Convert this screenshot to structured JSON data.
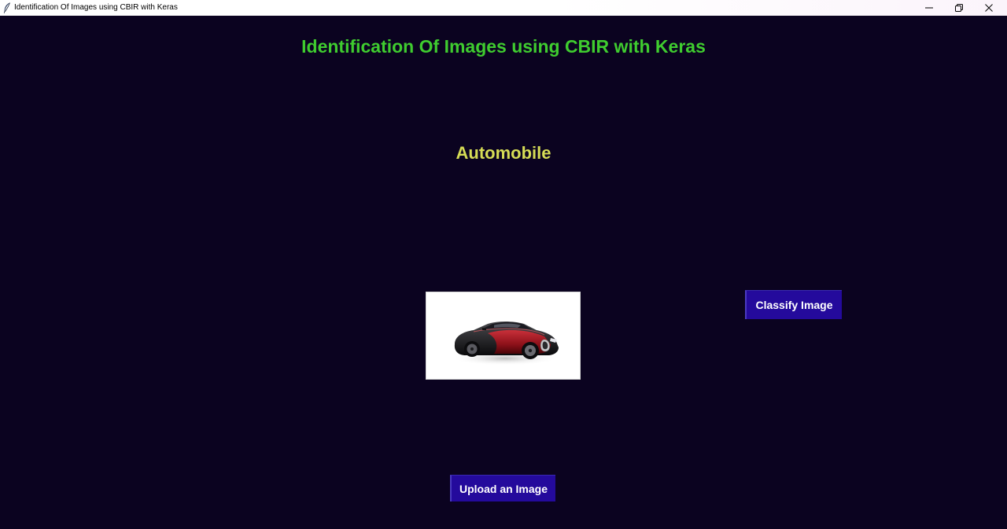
{
  "window": {
    "title": "Identification Of Images using CBIR with Keras",
    "app_icon": "feather-icon",
    "controls": [
      "minimize-icon",
      "restore-icon",
      "close-icon"
    ]
  },
  "header": {
    "title": "Identification Of Images using CBIR with Keras",
    "title_color": "#3fcc2f"
  },
  "result": {
    "label": "Automobile",
    "label_color": "#d6dc55"
  },
  "preview": {
    "image_subject": "red-black-sports-car"
  },
  "buttons": {
    "classify_label": "Classify Image",
    "upload_label": "Upload an Image",
    "button_color": "#240a9c"
  },
  "colors": {
    "background": "#0b0320"
  }
}
